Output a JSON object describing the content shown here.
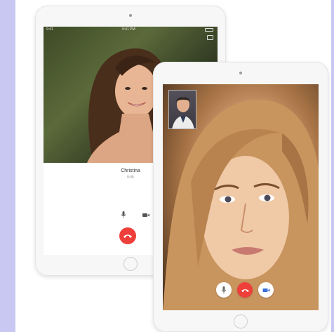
{
  "back_tablet": {
    "status_time": "9:41",
    "status_clock": "9:41 PM",
    "caller_name": "Christina",
    "caller_status": "0:05"
  },
  "front_tablet": {},
  "colors": {
    "end_call": "#ee3f3a",
    "background": "#c8c8f2"
  },
  "icons": {
    "mic": "mic-icon",
    "camera": "video-camera-icon",
    "speaker": "speaker-icon",
    "end_call": "end-call-icon"
  }
}
